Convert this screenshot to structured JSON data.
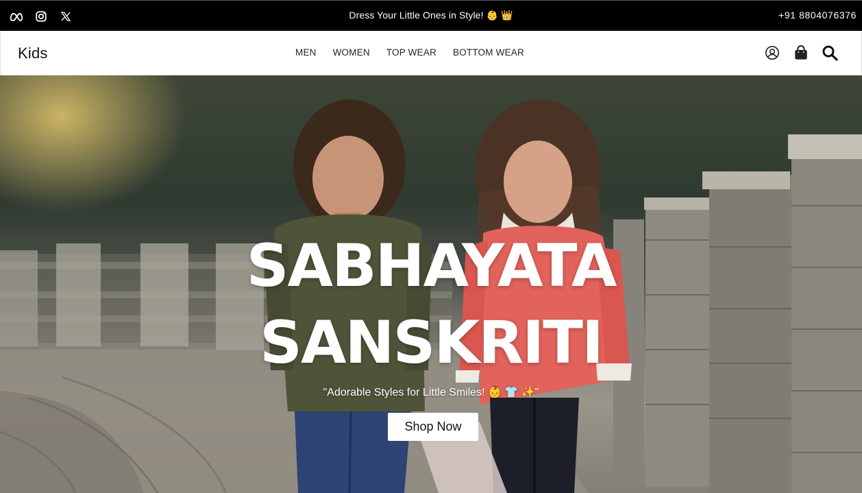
{
  "topbar": {
    "social": [
      {
        "icon": "meta-icon"
      },
      {
        "icon": "instagram-icon"
      },
      {
        "icon": "x-icon"
      }
    ],
    "promo": "Dress Your Little Ones in Style! 👶 👑",
    "phone": "+91 8804076376"
  },
  "nav": {
    "brand": "Kids",
    "links": [
      "MEN",
      "WOMEN",
      "TOP WEAR",
      "BOTTOM WEAR"
    ],
    "icons": [
      "user-icon",
      "shopping-bag-icon",
      "search-icon"
    ]
  },
  "hero": {
    "title_line1": "SABHAYATA",
    "title_line2": "SANSKRITI",
    "tagline": "\"Adorable Styles for Little Smiles! 👶 👕 ✨\"",
    "cta": "Shop Now"
  },
  "colors": {
    "topbar_bg": "#000000",
    "nav_bg": "#ffffff",
    "hero_text": "#ffffff",
    "button_bg": "#ffffff"
  }
}
